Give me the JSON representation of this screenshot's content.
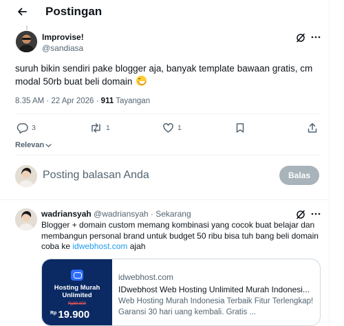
{
  "header": {
    "title": "Postingan"
  },
  "post": {
    "author_name": "Improvise!",
    "author_handle": "@sandiasa",
    "text": "suruh bikin sendiri pake blogger aja, banyak template bawaan gratis, cm modal 50rb buat beli domain",
    "emoji": "grinning-face-icon",
    "timestamp": "8.35 AM · 22 Apr 2026 · ",
    "views_count": "911",
    "views_label": " Tayangan"
  },
  "actions": {
    "replies": "3",
    "reposts": "1",
    "likes": "1"
  },
  "sort": {
    "label": "Relevan"
  },
  "compose": {
    "placeholder": "Posting balasan Anda",
    "reply_button": "Balas"
  },
  "reply": {
    "author_name": "wadriansyah",
    "author_handle": " @wadriansyah · Sekarang",
    "text_before": "Blogger + domain custom memang kombinasi yang cocok buat belajar dan membangun personal brand untuk budget 50 ribu bisa tuh bang beli domain coba ke ",
    "link": "idwebhost.com",
    "text_after": " ajah",
    "card": {
      "thumb_title": "Hosting Murah Unlimited",
      "thumb_old_price": "Rp89.900",
      "thumb_currency": "Rp",
      "thumb_price": "19.900",
      "domain": "idwebhost.com",
      "title": "IDwebhost Web Hosting Unlimited Murah Indonesi...",
      "description": "Web Hosting Murah Indonesia Terbaik Fitur Terlengkap! Garansi 30 hari uang kembali. Gratis ..."
    }
  },
  "colors": {
    "accent": "#1d9bf0",
    "text": "#0f1419",
    "muted": "#536471"
  }
}
